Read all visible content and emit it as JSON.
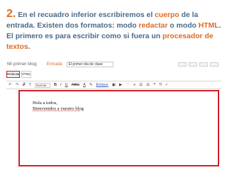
{
  "instruction": {
    "number": "2.",
    "part1": " En el  recuadro inferior escribiremos el ",
    "cuerpo": "cuerpo",
    "part2": " de la entrada. Existen dos formatos: modo ",
    "redactar": "redactar",
    "part3": " o modo ",
    "html": "HTML",
    "part4": ". El primero es para escribir como si fuera un ",
    "procesador": "procesador de textos",
    "part5": "."
  },
  "editor": {
    "blog_name": "Mi primer blog",
    "separator": "·",
    "section": "Entrada",
    "title_value": "El primer día de clase",
    "modes": {
      "compose": "Redactar",
      "html": "HTML"
    },
    "toolbar": {
      "undo": "↶",
      "redo": "↷",
      "font": "𝓕",
      "font_size": "T",
      "format_select": "Normal",
      "bold": "B",
      "italic": "I",
      "underline": "U",
      "strike": "ABC",
      "text_color": "A",
      "highlight": "✎",
      "link": "Enlace",
      "image": "▣",
      "video": "▶",
      "jump": "⋯",
      "align": "≡",
      "numbered_list": "☰",
      "bullet_list": "☰",
      "quote": "❝",
      "clear_format": "T̸",
      "spell": "✓"
    },
    "body_lines": [
      "Hola a todos,",
      "Bienvenidos a vuestro blog"
    ]
  },
  "colors": {
    "heading": "#4a6b8a",
    "accent": "#e16b1f",
    "highlight_border": "#d0202a"
  }
}
